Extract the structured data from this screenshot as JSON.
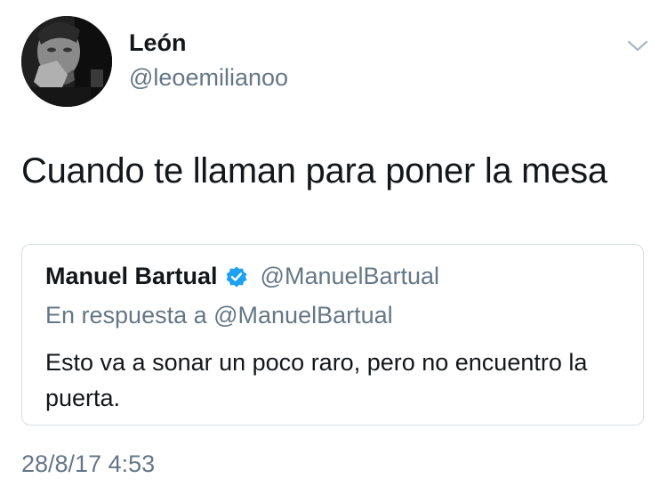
{
  "author": {
    "display_name": "León",
    "handle": "@leoemilianoo",
    "avatar_icon": "profile-photo"
  },
  "tweet": {
    "text": "Cuando te llaman para poner la mesa",
    "timestamp": "28/8/17 4:53"
  },
  "quoted_tweet": {
    "display_name": "Manuel Bartual",
    "verified": true,
    "handle": "@ManuelBartual",
    "reply_context": "En respuesta a @ManuelBartual",
    "text": "Esto va a sonar un poco raro, pero no encuentro la puerta."
  },
  "colors": {
    "primary_text": "#14171a",
    "secondary_text": "#657786",
    "border": "#d7dee3",
    "verified_blue": "#1da1f2"
  },
  "icons": {
    "menu": "chevron-down-icon",
    "verified": "verified-badge-icon"
  }
}
